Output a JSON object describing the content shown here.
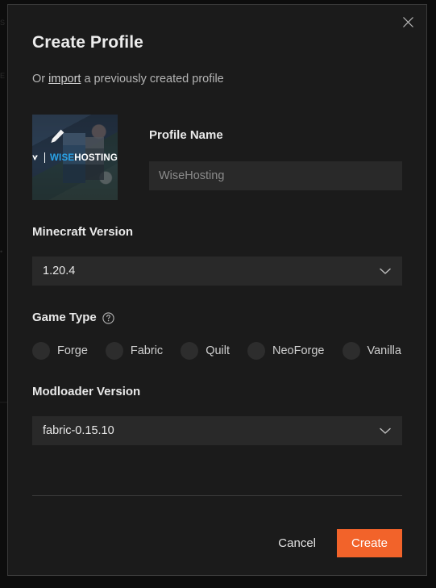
{
  "background": {
    "ghost_text_1": "S",
    "ghost_text_2": "E",
    "ghost_text_3": "•",
    "ghost_text_4": "—"
  },
  "modal": {
    "title": "Create Profile",
    "close_icon": "close-icon",
    "subtitle_prefix": "Or ",
    "subtitle_link": "import",
    "subtitle_suffix": " a previously created profile"
  },
  "avatar": {
    "edit_icon": "pencil-icon",
    "logo_mark": "wisehosting-logo-mark",
    "logo_text_primary": "WISE",
    "logo_text_secondary": "HOSTING"
  },
  "profile_name": {
    "label": "Profile Name",
    "value": "",
    "placeholder": "WiseHosting"
  },
  "minecraft_version": {
    "label": "Minecraft Version",
    "selected": "1.20.4",
    "chevron_icon": "chevron-down-icon",
    "options": [
      "1.20.4"
    ]
  },
  "game_type": {
    "label": "Game Type",
    "help_icon": "question-circle-icon",
    "selected": "Fabric",
    "options": [
      {
        "label": "Forge",
        "selected": false
      },
      {
        "label": "Fabric",
        "selected": true
      },
      {
        "label": "Quilt",
        "selected": false
      },
      {
        "label": "NeoForge",
        "selected": false
      },
      {
        "label": "Vanilla",
        "selected": false
      }
    ]
  },
  "modloader_version": {
    "label": "Modloader Version",
    "selected": "fabric-0.15.10",
    "chevron_icon": "chevron-down-icon",
    "options": [
      "fabric-0.15.10"
    ]
  },
  "footer": {
    "cancel_label": "Cancel",
    "create_label": "Create"
  },
  "colors": {
    "accent": "#f2632a",
    "modal_bg": "#1b1b1b",
    "input_bg": "#292929",
    "logo_blue": "#2aa3e8"
  }
}
